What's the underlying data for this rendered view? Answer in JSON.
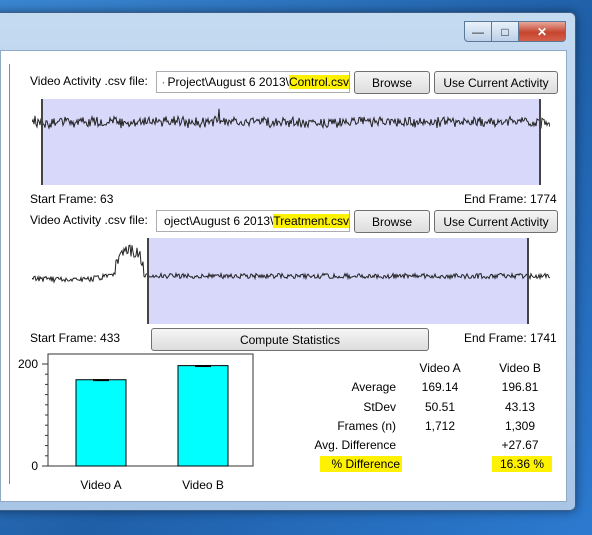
{
  "window": {
    "minimize_glyph": "—",
    "maximize_glyph": "□",
    "close_glyph": "✕"
  },
  "video_a": {
    "file_label": "Video Activity .csv file:",
    "path_dot": "·",
    "path_prefix": "Project\\August 6 2013\\",
    "path_file": "Control.csv",
    "browse_label": "Browse",
    "use_current_label": "Use Current Activity",
    "start_frame_label": "Start Frame: 63",
    "end_frame_label": "End Frame: 1774"
  },
  "video_b": {
    "file_label": "Video Activity .csv file:",
    "path_prefix": "oject\\August 6 2013\\",
    "path_file": "Treatment.csv",
    "browse_label": "Browse",
    "use_current_label": "Use Current Activity",
    "start_frame_label": "Start Frame: 433",
    "end_frame_label": "End Frame: 1741"
  },
  "compute_button_label": "Compute Statistics",
  "bar_chart": {
    "y_tick_top": "200",
    "y_tick_bottom": "0",
    "x_label_a": "Video A",
    "x_label_b": "Video B"
  },
  "chart_data": {
    "type": "bar",
    "categories": [
      "Video A",
      "Video B"
    ],
    "values": [
      169.14,
      196.81
    ],
    "error": [
      1.22,
      1.19
    ],
    "ylim": [
      0,
      200
    ],
    "bar_color": "#00ffff"
  },
  "stats": {
    "col_a": "Video A",
    "col_b": "Video B",
    "rows": [
      {
        "label": "Average",
        "a": "169.14",
        "b": "196.81"
      },
      {
        "label": "StDev",
        "a": "50.51",
        "b": "43.13"
      },
      {
        "label": "Frames (n)",
        "a": "1,712",
        "b": "1,309"
      },
      {
        "label": "Avg. Difference",
        "a": "",
        "b": "+27.67"
      },
      {
        "label": "% Difference",
        "a": "",
        "b": "16.36 %"
      }
    ]
  },
  "colors": {
    "selection_fill": "#d8d8fb",
    "highlight": "#fff200"
  }
}
